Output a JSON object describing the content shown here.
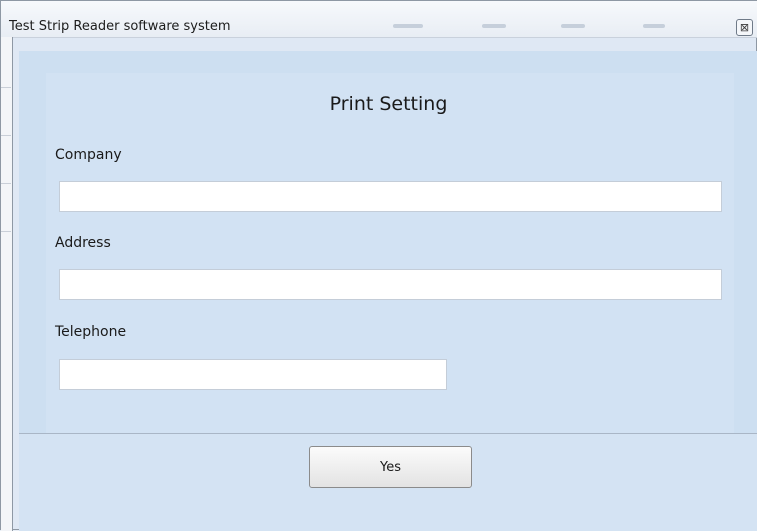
{
  "window": {
    "title": "Test Strip Reader software system",
    "close_glyph": "⊠"
  },
  "dialog": {
    "heading": "Print Setting",
    "fields": [
      {
        "label": "Company",
        "value": "",
        "placeholder": ""
      },
      {
        "label": "Address",
        "value": "",
        "placeholder": ""
      },
      {
        "label": "Telephone",
        "value": "",
        "placeholder": ""
      }
    ],
    "confirm_label": "Yes"
  },
  "colors": {
    "dialog_background": "#cddff1",
    "input_background": "#ffffff"
  }
}
